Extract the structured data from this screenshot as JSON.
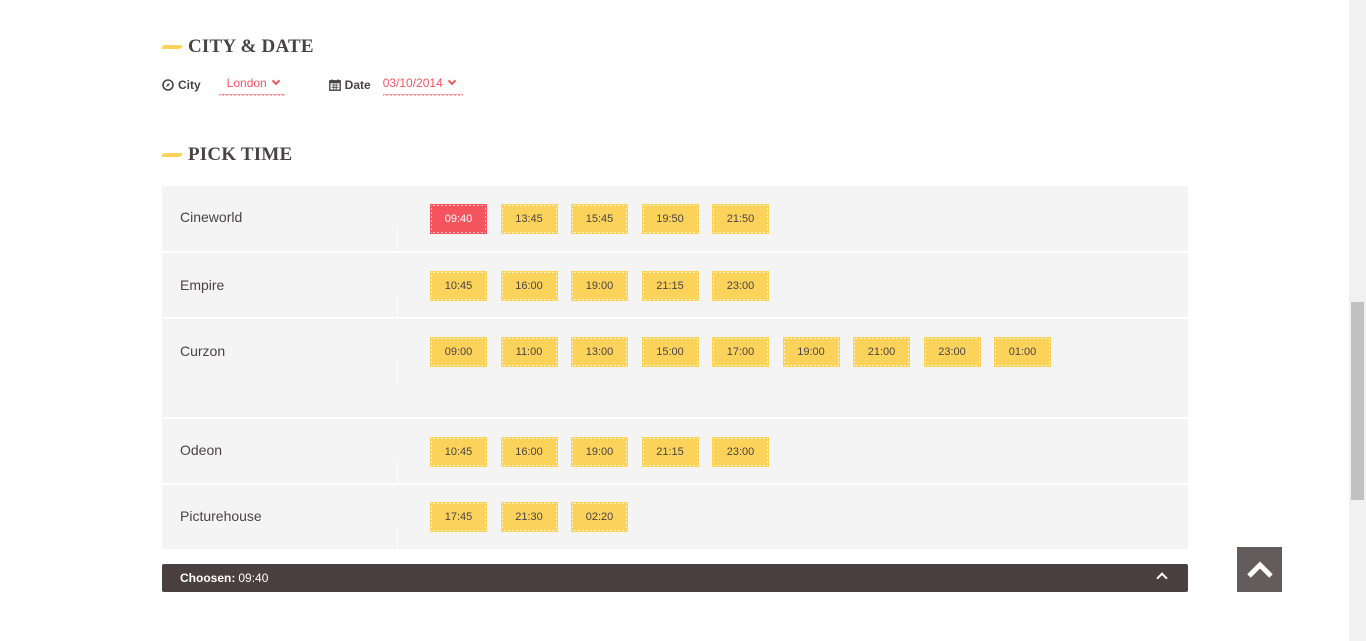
{
  "sections": {
    "city_date_title": "CITY & DATE",
    "pick_time_title": "PICK TIME"
  },
  "filters": {
    "city_label": "City",
    "city_value": "London",
    "date_label": "Date",
    "date_value": "03/10/2014"
  },
  "schedule": [
    {
      "cinema": "Cineworld",
      "times": [
        "09:40",
        "13:45",
        "15:45",
        "19:50",
        "21:50"
      ]
    },
    {
      "cinema": "Empire",
      "times": [
        "10:45",
        "16:00",
        "19:00",
        "21:15",
        "23:00"
      ]
    },
    {
      "cinema": "Curzon",
      "times": [
        "09:00",
        "11:00",
        "13:00",
        "15:00",
        "17:00",
        "19:00",
        "21:00",
        "23:00",
        "01:00"
      ]
    },
    {
      "cinema": "Odeon",
      "times": [
        "10:45",
        "16:00",
        "19:00",
        "21:15",
        "23:00"
      ]
    },
    {
      "cinema": "Picturehouse",
      "times": [
        "17:45",
        "21:30",
        "02:20"
      ]
    }
  ],
  "selected": {
    "row": 0,
    "time": "09:40"
  },
  "chosen": {
    "label": "Choosen:",
    "value": "09:40"
  },
  "colors": {
    "accent": "#f3545e",
    "ticket": "#fcd35a",
    "dark": "#4a3f41",
    "row_bg": "#f4f4f4"
  },
  "icons": {
    "city": "compass-icon",
    "date": "calendar-icon",
    "back_to_top": "arrow-up-icon",
    "chosen_toggle": "chevron-up-icon"
  }
}
